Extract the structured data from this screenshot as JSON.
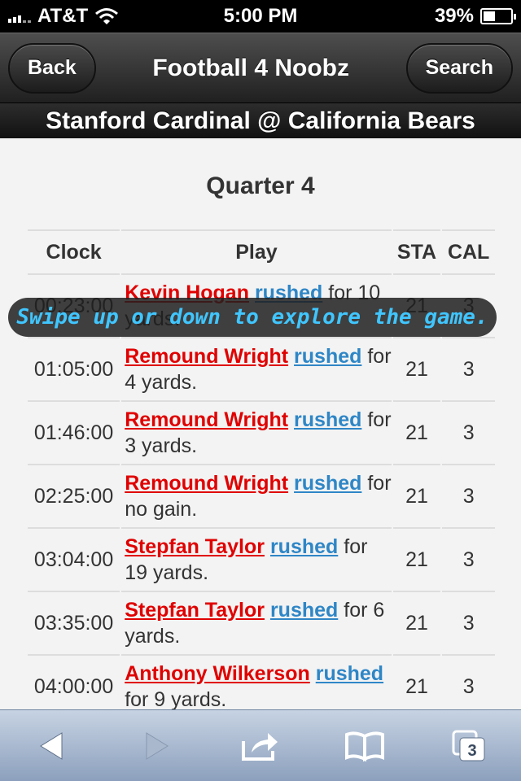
{
  "status_bar": {
    "carrier": "AT&T",
    "time": "5:00 PM",
    "battery": "39%"
  },
  "header": {
    "back_label": "Back",
    "title": "Football 4 Noobz",
    "search_label": "Search"
  },
  "subheader": {
    "title": "Stanford Cardinal @ California Bears"
  },
  "quarter_title": "Quarter 4",
  "table": {
    "headers": {
      "clock": "Clock",
      "play": "Play",
      "sta": "STA",
      "cal": "CAL"
    },
    "rows": [
      {
        "clock": "00:23:00",
        "player": "Kevin Hogan",
        "action": "rushed",
        "desc": "for 10 yards.",
        "sta": "21",
        "cal": "3"
      },
      {
        "clock": "01:05:00",
        "player": "Remound Wright",
        "action": "rushed",
        "desc": "for 4 yards.",
        "sta": "21",
        "cal": "3"
      },
      {
        "clock": "01:46:00",
        "player": "Remound Wright",
        "action": "rushed",
        "desc": "for 3 yards.",
        "sta": "21",
        "cal": "3"
      },
      {
        "clock": "02:25:00",
        "player": "Remound Wright",
        "action": "rushed",
        "desc": "for no gain.",
        "sta": "21",
        "cal": "3"
      },
      {
        "clock": "03:04:00",
        "player": "Stepfan Taylor",
        "action": "rushed",
        "desc": "for 19 yards.",
        "sta": "21",
        "cal": "3"
      },
      {
        "clock": "03:35:00",
        "player": "Stepfan Taylor",
        "action": "rushed",
        "desc": "for 6 yards.",
        "sta": "21",
        "cal": "3"
      },
      {
        "clock": "04:00:00",
        "player": "Anthony Wilkerson",
        "action": "rushed",
        "desc": "for 9 yards.",
        "sta": "21",
        "cal": "3"
      }
    ]
  },
  "overlay_text": "Swipe up or down to explore the game.",
  "toolbar": {
    "tabs_count": "3",
    "icons": [
      "back-arrow-icon",
      "forward-arrow-icon",
      "share-icon",
      "bookmarks-icon",
      "tabs-icon"
    ]
  },
  "colors": {
    "player": "#e00000",
    "action": "#2e86c6",
    "overlay_text": "#40c6ff"
  }
}
